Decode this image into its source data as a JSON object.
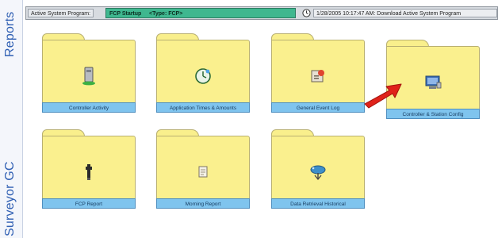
{
  "rail": {
    "top_label": "Reports",
    "bottom_label": "Surveyor GC"
  },
  "status_bar": {
    "label": "Active System Program:",
    "program": "FCP Startup     <Type: FCP>",
    "clock_icon": "clock-icon",
    "message": "1/28/2005 10:17:47 AM: Download Active System Program"
  },
  "folders": [
    {
      "label": "Controller Activity",
      "icon": "controller-activity-icon"
    },
    {
      "label": "Application Times & Amounts",
      "icon": "application-times-icon"
    },
    {
      "label": "General Event Log",
      "icon": "event-log-icon"
    },
    {
      "label": "Controller & Station Config",
      "icon": "controller-config-icon"
    },
    {
      "label": "FCP Report",
      "icon": "fcp-report-icon"
    },
    {
      "label": "Morning Report",
      "icon": "morning-report-icon"
    },
    {
      "label": "Data Retrieval Historical",
      "icon": "data-retrieval-icon"
    }
  ],
  "colors": {
    "folder": "#faf08e",
    "label_bar": "#7fc4ee",
    "rail_text": "#2f5fb3",
    "program_field": "#3fb78f",
    "arrow": "#e0221a"
  }
}
